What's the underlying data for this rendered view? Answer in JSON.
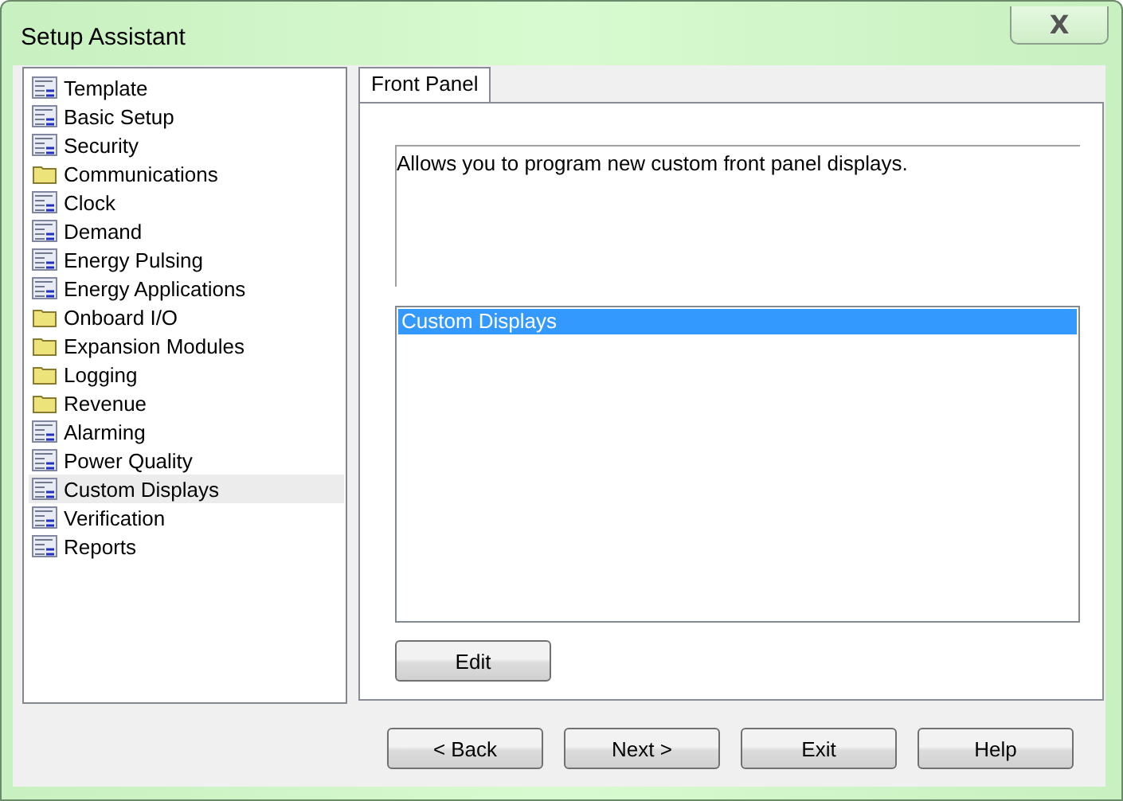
{
  "window": {
    "title": "Setup Assistant",
    "close": "X"
  },
  "sidebar": {
    "items": [
      {
        "label": "Template",
        "kind": "document",
        "selected": false
      },
      {
        "label": "Basic Setup",
        "kind": "document",
        "selected": false
      },
      {
        "label": "Security",
        "kind": "document",
        "selected": false
      },
      {
        "label": "Communications",
        "kind": "folder",
        "selected": false
      },
      {
        "label": "Clock",
        "kind": "document",
        "selected": false
      },
      {
        "label": "Demand",
        "kind": "document",
        "selected": false
      },
      {
        "label": "Energy Pulsing",
        "kind": "document",
        "selected": false
      },
      {
        "label": "Energy Applications",
        "kind": "document",
        "selected": false
      },
      {
        "label": "Onboard I/O",
        "kind": "folder",
        "selected": false
      },
      {
        "label": "Expansion Modules",
        "kind": "folder",
        "selected": false
      },
      {
        "label": "Logging",
        "kind": "folder",
        "selected": false
      },
      {
        "label": "Revenue",
        "kind": "folder",
        "selected": false
      },
      {
        "label": "Alarming",
        "kind": "document",
        "selected": false
      },
      {
        "label": "Power Quality",
        "kind": "document",
        "selected": false
      },
      {
        "label": "Custom Displays",
        "kind": "document",
        "selected": true
      },
      {
        "label": "Verification",
        "kind": "document",
        "selected": false
      },
      {
        "label": "Reports",
        "kind": "document",
        "selected": false
      }
    ]
  },
  "tabs": [
    {
      "label": "Front Panel",
      "selected": true
    }
  ],
  "description": "Allows you to program new custom front panel displays.",
  "list": {
    "items": [
      {
        "label": "Custom Displays",
        "selected": true
      }
    ]
  },
  "edit_button": "Edit",
  "buttons": [
    "< Back",
    "Next >",
    "Exit",
    "Help"
  ]
}
